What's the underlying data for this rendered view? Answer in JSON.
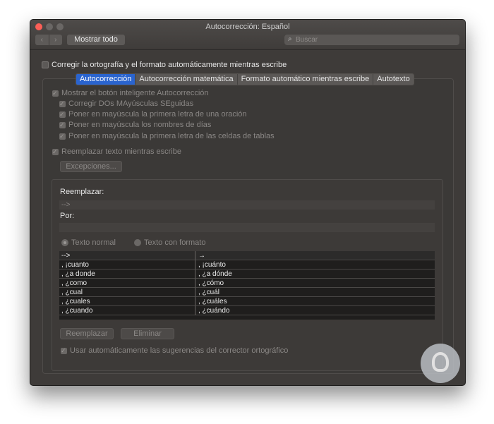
{
  "window": {
    "title": "Autocorrección: Español"
  },
  "toolbar": {
    "back_icon": "‹",
    "forward_icon": "›",
    "show_all": "Mostrar todo"
  },
  "search": {
    "placeholder": "Buscar",
    "value": ""
  },
  "main_checkbox": {
    "label": "Corregir la ortografía y el formato automáticamente mientras escribe",
    "checked": false
  },
  "tabs": [
    {
      "label": "Autocorrección",
      "active": true
    },
    {
      "label": "Autocorrección matemática",
      "active": false
    },
    {
      "label": "Formato automático mientras escribe",
      "active": false
    },
    {
      "label": "Autotexto",
      "active": false
    }
  ],
  "options": {
    "show_smart_button": "Mostrar el botón inteligente Autocorrección",
    "correct_two_caps": "Corregir DOs MAyúsculas SEguidas",
    "capitalize_sentence": "Poner en mayúscula la primera letra de una oración",
    "capitalize_days": "Poner en mayúscula los nombres de días",
    "capitalize_table_cells": "Poner en mayúscula la primera letra de las celdas de tablas",
    "replace_text": "Reemplazar texto mientras escribe",
    "exceptions_button": "Excepciones..."
  },
  "replace": {
    "replace_label": "Reemplazar:",
    "replace_value": "-->",
    "with_label": "Por:",
    "with_value": "",
    "plain_text": "Texto normal",
    "formatted_text": "Texto con formato"
  },
  "table": {
    "rows": [
      {
        "from": "-->",
        "to": "→"
      },
      {
        "from": ", ¡cuanto",
        "to": ", ¡cuánto"
      },
      {
        "from": ", ¿a donde",
        "to": ", ¿a dónde"
      },
      {
        "from": ", ¿como",
        "to": ", ¿cómo"
      },
      {
        "from": ", ¿cual",
        "to": ", ¿cuál"
      },
      {
        "from": ", ¿cuales",
        "to": ", ¿cuáles"
      },
      {
        "from": ", ¿cuando",
        "to": ", ¿cuándo"
      }
    ]
  },
  "actions": {
    "replace_button": "Reemplazar",
    "delete_button": "Eliminar",
    "auto_suggestions": "Usar automáticamente las sugerencias del corrector ortográfico"
  },
  "colors": {
    "accent": "#2a64cf",
    "window_bg": "#3e3b39",
    "close": "#fc5f57"
  }
}
